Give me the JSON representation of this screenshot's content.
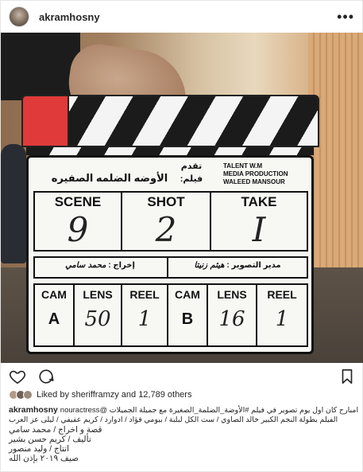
{
  "header": {
    "username": "akramhosny",
    "more_glyph": "•••"
  },
  "slate": {
    "top_right": [
      "TALENT W.M",
      "MEDIA PRODUCTION",
      "WALEED MANSOUR"
    ],
    "presents": "تقدم",
    "film_label": "فيلم:",
    "film_title": "الأوضه الضلمه الصفيره",
    "scene_label": "SCENE",
    "shot_label": "SHOT",
    "take_label": "TAKE",
    "scene_value": "9",
    "shot_value": "2",
    "take_value": "I",
    "director_label": "إخراج :",
    "director_name": "محمد سامي",
    "dop_label": "مدير التصوير :",
    "dop_name": "هيثم زنيتا",
    "cam_a_label": "CAM",
    "cam_a_value": "A",
    "lens_a_label": "LENS",
    "lens_a_value": "50",
    "reel_a_label": "REEL",
    "reel_a_value": "1",
    "cam_b_label": "CAM",
    "cam_b_value": "B",
    "lens_b_label": "LENS",
    "lens_b_value": "16",
    "reel_b_label": "REEL",
    "reel_b_value": "1"
  },
  "actions": {
    "like_icon": "heart-icon",
    "comment_icon": "comment-icon",
    "save_icon": "bookmark-icon"
  },
  "likes": {
    "text": "Liked by sherifframzy and 12,789 others"
  },
  "caption": {
    "username": "akramhosny",
    "lines": [
      "امبارح كان اول يوم تصوير في فيلم #الأوضة_الضلمة_الصغيرة مع جميلة الجميلات @nouractress",
      "الفيلم بطولة النجم الكبير خالد الصاوي / ست الكل لبلبة / بيومي فؤاد / ادوارد / كريم عفيفي / ليلى عز العرب",
      "قصة و اخراج / محمد سامي",
      "تأليف / كريم حسن بشير",
      "انتاج / وليد منصور",
      "صيف ٢٠١٩ بإذن الله"
    ]
  }
}
